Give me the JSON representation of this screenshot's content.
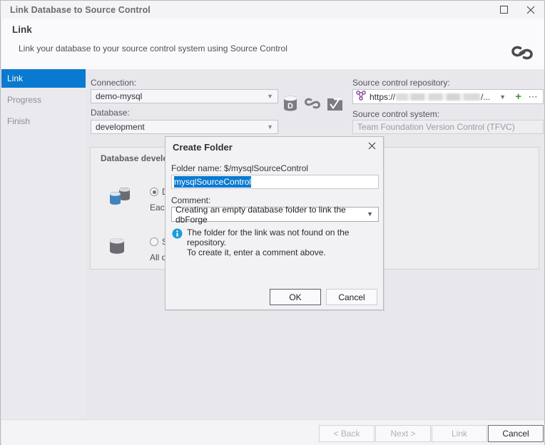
{
  "window": {
    "title": "Link Database to Source Control",
    "maximize_icon": "maximize-icon",
    "close_icon": "close-icon"
  },
  "header": {
    "title": "Link",
    "subtitle": "Link your database to your source control system using Source Control",
    "icon": "chain-link-icon"
  },
  "sidebar": {
    "items": [
      {
        "label": "Link",
        "active": true
      },
      {
        "label": "Progress",
        "active": false
      },
      {
        "label": "Finish",
        "active": false
      }
    ]
  },
  "form": {
    "connection_label": "Connection:",
    "connection_value": "demo-mysql",
    "database_label": "Database:",
    "database_value": "development",
    "repository_label": "Source control repository:",
    "repository_scheme": "https://",
    "repository_suffix": "/...",
    "repository_redacted": true,
    "system_label": "Source control system:",
    "system_value": "Team Foundation Version Control (TFVC)",
    "icons": [
      "database-d-icon",
      "chain-link-icon",
      "folder-check-icon"
    ],
    "repo_icon": "source-control-branch-icon",
    "repo_dropdown_icon": "chevron-down-icon",
    "repo_add_icon": "plus-icon",
    "repo_more_icon": "ellipsis-icon"
  },
  "group": {
    "title": "Database develo",
    "options": [
      {
        "radio_label": "D",
        "selected": true,
        "description": "Each"
      },
      {
        "radio_label": "Sh",
        "selected": false,
        "description": "All de"
      }
    ]
  },
  "footer": {
    "back": "< Back",
    "next": "Next >",
    "link": "Link",
    "cancel": "Cancel"
  },
  "dialog": {
    "title": "Create Folder",
    "close_icon": "close-icon",
    "folder_name_label": "Folder name: $/mysqlSourceControl",
    "folder_name_value": "mysqlSourceControl",
    "comment_label": "Comment:",
    "comment_value": "Creating an empty database folder to link the dbForge",
    "comment_caret_icon": "chevron-down-icon",
    "info_icon": "info-icon",
    "info_text": "The folder for the link was not found on the repository.\nTo create it, enter a comment above.",
    "ok": "OK",
    "cancel": "Cancel"
  },
  "colors": {
    "accent": "#0A7AD0",
    "selection": "#0A7AD0",
    "plus": "#3D9A3D",
    "info": "#1B9CD8",
    "window_bg": "#E7E7EC"
  }
}
